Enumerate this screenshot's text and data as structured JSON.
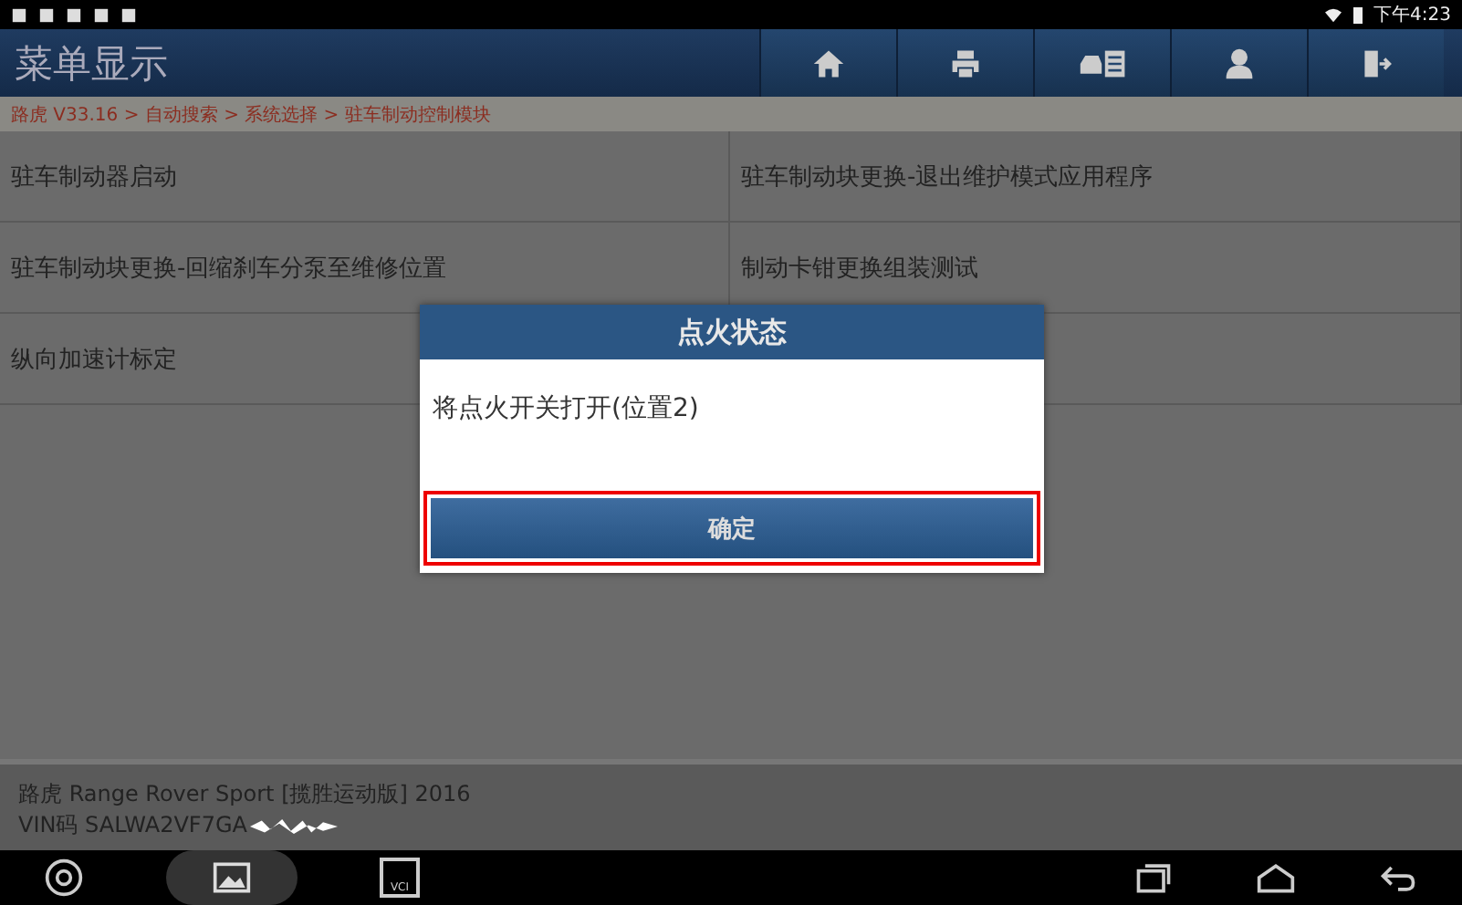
{
  "status_bar": {
    "time": "下午4:23"
  },
  "header": {
    "title": "菜单显示",
    "buttons": [
      {
        "kind": "home"
      },
      {
        "kind": "print"
      },
      {
        "kind": "car-report"
      },
      {
        "kind": "user"
      },
      {
        "kind": "exit"
      }
    ]
  },
  "breadcrumb": "路虎 V33.16 > 自动搜索 > 系统选择 > 驻车制动控制模块",
  "menu_items": [
    {
      "label": "驻车制动器启动"
    },
    {
      "label": "驻车制动块更换-退出维护模式应用程序"
    },
    {
      "label": "驻车制动块更换-回缩刹车分泵至维修位置"
    },
    {
      "label": "制动卡钳更换组装测试"
    },
    {
      "label": "纵向加速计标定"
    }
  ],
  "dialog": {
    "title": "点火状态",
    "message": "将点火开关打开(位置2)",
    "button": "确定",
    "highlighted": true
  },
  "footer": {
    "vehicle": "路虎 Range Rover Sport [揽胜运动版] 2016",
    "vin": "VIN码 SALWA2VF7GA"
  },
  "nav_bar": {
    "vci_label": "VCI"
  }
}
